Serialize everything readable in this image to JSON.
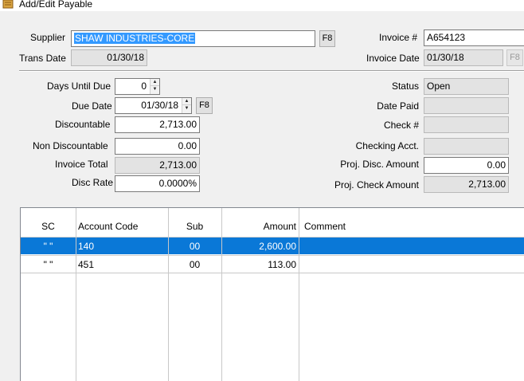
{
  "window": {
    "title": "Add/Edit Payable"
  },
  "header": {
    "supplier_label": "Supplier",
    "supplier_value": "SHAW INDUSTRIES-CORE",
    "supplier_lookup": "F8",
    "trans_date_label": "Trans Date",
    "trans_date_value": "01/30/18",
    "invoice_label": "Invoice #",
    "invoice_value": "A654123",
    "invoice_date_label": "Invoice Date",
    "invoice_date_value": "01/30/18",
    "invoice_date_lookup": "F8"
  },
  "details": {
    "days_until_due_label": "Days Until Due",
    "days_until_due_value": "0",
    "due_date_label": "Due Date",
    "due_date_value": "01/30/18",
    "due_date_lookup": "F8",
    "discountable_label": "Discountable",
    "discountable_value": "2,713.00",
    "non_discountable_label": "Non Discountable",
    "non_discountable_value": "0.00",
    "invoice_total_label": "Invoice Total",
    "invoice_total_value": "2,713.00",
    "disc_rate_label": "Disc Rate",
    "disc_rate_value": "0.0000%",
    "status_label": "Status",
    "status_value": "Open",
    "date_paid_label": "Date Paid",
    "date_paid_value": "",
    "check_label": "Check #",
    "check_value": "",
    "checking_acct_label": "Checking Acct.",
    "checking_acct_value": "",
    "proj_disc_amount_label": "Proj. Disc. Amount",
    "proj_disc_amount_value": "0.00",
    "proj_check_amount_label": "Proj. Check Amount",
    "proj_check_amount_value": "2,713.00"
  },
  "grid": {
    "columns": [
      "SC",
      "Account Code",
      "Sub",
      "Amount",
      "Comment"
    ],
    "rows": [
      {
        "sc": "\" \"",
        "account_code": "140",
        "sub": "00",
        "amount": "2,600.00",
        "comment": ""
      },
      {
        "sc": "\" \"",
        "account_code": "451",
        "sub": "00",
        "amount": "113.00",
        "comment": ""
      }
    ]
  },
  "colors": {
    "selection": "#0a78d7",
    "text_selection": "#3399ff"
  },
  "icons": {
    "title": "ledger-icon"
  }
}
